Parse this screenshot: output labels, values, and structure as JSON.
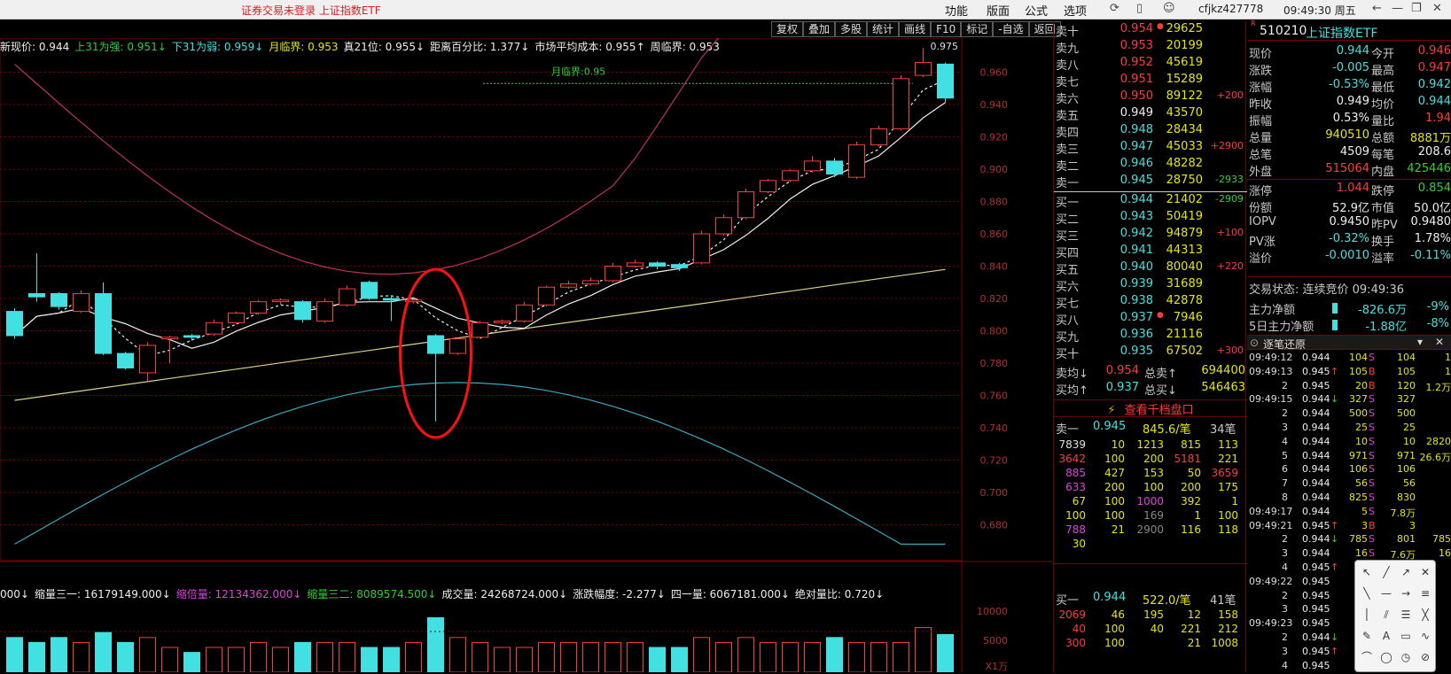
{
  "titlebar": {
    "notice": "证券交易未登录  上证指数ETF",
    "menus": [
      "功能",
      "版面",
      "公式",
      "选项"
    ],
    "account": "cfjkz427778",
    "clock": "09:49:30 周五"
  },
  "toolbar": [
    "复权",
    "叠加",
    "多股",
    "统计",
    "画线",
    "F10",
    "标记",
    "-自选",
    "返回"
  ],
  "infoline": [
    {
      "text": "新现价: 0.944",
      "color": "white"
    },
    {
      "text": "上31为强: 0.951↓",
      "color": "green"
    },
    {
      "text": "下31为弱: 0.959↓",
      "color": "cyan"
    },
    {
      "text": "月临界: 0.953",
      "color": "yellow"
    },
    {
      "text": "真21位: 0.955↓",
      "color": "white"
    },
    {
      "text": "距离百分比: 1.377↓",
      "color": "white"
    },
    {
      "text": "市场平均成本: 0.955↑",
      "color": "white"
    },
    {
      "text": "周临界: 0.953",
      "color": "white"
    }
  ],
  "volinfo": [
    {
      "text": "000↓",
      "color": "white"
    },
    {
      "text": "缩量三一: 16179149.000↓",
      "color": "white"
    },
    {
      "text": "缩倍量: 12134362.000↓",
      "color": "magenta"
    },
    {
      "text": "缩量三二: 8089574.500↓",
      "color": "green"
    },
    {
      "text": "成交量: 24268724.000↓",
      "color": "white"
    },
    {
      "text": "涨跌幅度: -2.277↓",
      "color": "white"
    },
    {
      "text": "四一量: 6067181.000↓",
      "color": "white"
    },
    {
      "text": "绝对量比: 0.720↓",
      "color": "white"
    }
  ],
  "chart_data": {
    "type": "candlestick",
    "annotations": {
      "month_critical_label": "月临界:0.95",
      "high_label": "0.975"
    },
    "ylim": [
      0.66,
      0.98
    ],
    "yticks": [
      0.68,
      0.7,
      0.72,
      0.74,
      0.76,
      0.78,
      0.8,
      0.82,
      0.84,
      0.86,
      0.88,
      0.9,
      0.92,
      0.94,
      0.96
    ],
    "vol_ticks": [
      "10000",
      "5000",
      "X1万"
    ],
    "candles": [
      {
        "o": 0.812,
        "c": 0.797,
        "h": 0.814,
        "l": 0.795
      },
      {
        "o": 0.823,
        "c": 0.821,
        "h": 0.848,
        "l": 0.818
      },
      {
        "o": 0.823,
        "c": 0.815,
        "h": 0.824,
        "l": 0.813
      },
      {
        "o": 0.812,
        "c": 0.823,
        "h": 0.825,
        "l": 0.811
      },
      {
        "o": 0.823,
        "c": 0.786,
        "h": 0.83,
        "l": 0.785
      },
      {
        "o": 0.786,
        "c": 0.777,
        "h": 0.787,
        "l": 0.776
      },
      {
        "o": 0.774,
        "c": 0.791,
        "h": 0.793,
        "l": 0.769
      },
      {
        "o": 0.795,
        "c": 0.796,
        "h": 0.797,
        "l": 0.78
      },
      {
        "o": 0.797,
        "c": 0.796,
        "h": 0.798,
        "l": 0.794
      },
      {
        "o": 0.798,
        "c": 0.805,
        "h": 0.807,
        "l": 0.797
      },
      {
        "o": 0.805,
        "c": 0.811,
        "h": 0.812,
        "l": 0.804
      },
      {
        "o": 0.811,
        "c": 0.818,
        "h": 0.819,
        "l": 0.81
      },
      {
        "o": 0.818,
        "c": 0.819,
        "h": 0.82,
        "l": 0.816
      },
      {
        "o": 0.818,
        "c": 0.807,
        "h": 0.819,
        "l": 0.805
      },
      {
        "o": 0.806,
        "c": 0.818,
        "h": 0.82,
        "l": 0.805
      },
      {
        "o": 0.816,
        "c": 0.826,
        "h": 0.828,
        "l": 0.815
      },
      {
        "o": 0.83,
        "c": 0.82,
        "h": 0.831,
        "l": 0.819
      },
      {
        "o": 0.82,
        "c": 0.819,
        "h": 0.822,
        "l": 0.806
      },
      {
        "o": 0.818,
        "c": 0.819,
        "h": 0.819,
        "l": 0.817
      },
      {
        "o": 0.797,
        "c": 0.786,
        "h": 0.798,
        "l": 0.744
      },
      {
        "o": 0.786,
        "c": 0.795,
        "h": 0.796,
        "l": 0.785
      },
      {
        "o": 0.796,
        "c": 0.805,
        "h": 0.806,
        "l": 0.795
      },
      {
        "o": 0.805,
        "c": 0.806,
        "h": 0.807,
        "l": 0.804
      },
      {
        "o": 0.806,
        "c": 0.816,
        "h": 0.818,
        "l": 0.805
      },
      {
        "o": 0.816,
        "c": 0.827,
        "h": 0.828,
        "l": 0.815
      },
      {
        "o": 0.827,
        "c": 0.829,
        "h": 0.831,
        "l": 0.826
      },
      {
        "o": 0.829,
        "c": 0.831,
        "h": 0.833,
        "l": 0.828
      },
      {
        "o": 0.831,
        "c": 0.84,
        "h": 0.842,
        "l": 0.83
      },
      {
        "o": 0.84,
        "c": 0.842,
        "h": 0.844,
        "l": 0.839
      },
      {
        "o": 0.842,
        "c": 0.84,
        "h": 0.843,
        "l": 0.838
      },
      {
        "o": 0.841,
        "c": 0.839,
        "h": 0.842,
        "l": 0.837
      },
      {
        "o": 0.842,
        "c": 0.86,
        "h": 0.862,
        "l": 0.841
      },
      {
        "o": 0.86,
        "c": 0.87,
        "h": 0.872,
        "l": 0.859
      },
      {
        "o": 0.87,
        "c": 0.886,
        "h": 0.888,
        "l": 0.869
      },
      {
        "o": 0.886,
        "c": 0.893,
        "h": 0.894,
        "l": 0.885
      },
      {
        "o": 0.893,
        "c": 0.899,
        "h": 0.9,
        "l": 0.892
      },
      {
        "o": 0.899,
        "c": 0.905,
        "h": 0.908,
        "l": 0.898
      },
      {
        "o": 0.905,
        "c": 0.897,
        "h": 0.907,
        "l": 0.895
      },
      {
        "o": 0.895,
        "c": 0.915,
        "h": 0.917,
        "l": 0.894
      },
      {
        "o": 0.915,
        "c": 0.925,
        "h": 0.927,
        "l": 0.914
      },
      {
        "o": 0.925,
        "c": 0.956,
        "h": 0.958,
        "l": 0.924
      },
      {
        "o": 0.958,
        "c": 0.966,
        "h": 0.975,
        "l": 0.957
      },
      {
        "o": 0.965,
        "c": 0.944,
        "h": 0.966,
        "l": 0.941
      }
    ],
    "volumes": [
      0.35,
      0.3,
      0.35,
      0.3,
      0.4,
      0.3,
      0.35,
      0.25,
      0.2,
      0.25,
      0.25,
      0.3,
      0.25,
      0.3,
      0.3,
      0.3,
      0.25,
      0.25,
      0.3,
      0.55,
      0.35,
      0.3,
      0.25,
      0.25,
      0.3,
      0.3,
      0.3,
      0.3,
      0.3,
      0.25,
      0.25,
      0.35,
      0.3,
      0.35,
      0.3,
      0.3,
      0.3,
      0.35,
      0.3,
      0.3,
      0.3,
      0.45,
      0.38
    ]
  },
  "orderbook": {
    "asks": [
      {
        "label": "卖十",
        "price": "0.954",
        "vol": "29625",
        "chg": "",
        "pc": "red",
        "mark": "●"
      },
      {
        "label": "卖九",
        "price": "0.953",
        "vol": "20199",
        "chg": "",
        "pc": "red",
        "mark": ""
      },
      {
        "label": "卖八",
        "price": "0.952",
        "vol": "45619",
        "chg": "",
        "pc": "red",
        "mark": ""
      },
      {
        "label": "卖七",
        "price": "0.951",
        "vol": "15289",
        "chg": "",
        "pc": "red",
        "mark": ""
      },
      {
        "label": "卖六",
        "price": "0.950",
        "vol": "89122",
        "chg": "+200",
        "pc": "red",
        "mark": ""
      },
      {
        "label": "卖五",
        "price": "0.949",
        "vol": "43570",
        "chg": "",
        "pc": "white",
        "mark": ""
      },
      {
        "label": "卖四",
        "price": "0.948",
        "vol": "28434",
        "chg": "",
        "pc": "cyan",
        "mark": ""
      },
      {
        "label": "卖三",
        "price": "0.947",
        "vol": "45033",
        "chg": "+2900",
        "pc": "cyan",
        "mark": ""
      },
      {
        "label": "卖二",
        "price": "0.946",
        "vol": "48282",
        "chg": "",
        "pc": "cyan",
        "mark": ""
      },
      {
        "label": "卖一",
        "price": "0.945",
        "vol": "28750",
        "chg": "-2933",
        "pc": "cyan",
        "mark": ""
      }
    ],
    "bids": [
      {
        "label": "买一",
        "price": "0.944",
        "vol": "21402",
        "chg": "-2909",
        "pc": "cyan",
        "mark": ""
      },
      {
        "label": "买二",
        "price": "0.943",
        "vol": "50419",
        "chg": "",
        "pc": "cyan",
        "mark": ""
      },
      {
        "label": "买三",
        "price": "0.942",
        "vol": "94879",
        "chg": "+100",
        "pc": "cyan",
        "mark": ""
      },
      {
        "label": "买四",
        "price": "0.941",
        "vol": "44313",
        "chg": "",
        "pc": "cyan",
        "mark": ""
      },
      {
        "label": "买五",
        "price": "0.940",
        "vol": "80040",
        "chg": "+220",
        "pc": "cyan",
        "mark": ""
      },
      {
        "label": "买六",
        "price": "0.939",
        "vol": "31689",
        "chg": "",
        "pc": "cyan",
        "mark": ""
      },
      {
        "label": "买七",
        "price": "0.938",
        "vol": "42878",
        "chg": "",
        "pc": "cyan",
        "mark": ""
      },
      {
        "label": "买八",
        "price": "0.937",
        "vol": "7946",
        "chg": "",
        "pc": "cyan",
        "mark": "●"
      },
      {
        "label": "买九",
        "price": "0.936",
        "vol": "21116",
        "chg": "",
        "pc": "cyan",
        "mark": ""
      },
      {
        "label": "买十",
        "price": "0.935",
        "vol": "67502",
        "chg": "+300",
        "pc": "cyan",
        "mark": ""
      }
    ],
    "avg_sell": {
      "label": "卖均↓",
      "price": "0.954",
      "tlabel": "总卖↑",
      "total": "694400"
    },
    "avg_buy": {
      "label": "买均↑",
      "price": "0.937",
      "tlabel": "总买↓",
      "total": "546463"
    },
    "depth_button": "查看千档盘口",
    "ask1_header": {
      "label": "卖一",
      "price": "0.945",
      "per": "845.6/笔",
      "count": "34笔"
    },
    "ask1_queue": [
      [
        "7839",
        "10",
        "1213",
        "815",
        "113"
      ],
      [
        "3642",
        "100",
        "200",
        "5181",
        "221"
      ],
      [
        "885",
        "427",
        "153",
        "50",
        "3659"
      ],
      [
        "633",
        "200",
        "100",
        "200",
        "175"
      ],
      [
        "67",
        "100",
        "1000",
        "392",
        "1"
      ],
      [
        "100",
        "100",
        "169",
        "1",
        "100"
      ],
      [
        "788",
        "21",
        "2900",
        "116",
        "118"
      ],
      [
        "30",
        "",
        "",
        "",
        ""
      ]
    ],
    "bid1_header": {
      "label": "买一",
      "price": "0.944",
      "per": "522.0/笔",
      "count": "41笔"
    },
    "bid1_queue": [
      [
        "2069",
        "46",
        "195",
        "12",
        "158"
      ],
      [
        "40",
        "100",
        "40",
        "221",
        "212"
      ],
      [
        "300",
        "100",
        "",
        "21",
        "1008"
      ]
    ]
  },
  "quote": {
    "code": "510210",
    "name": "上证指数ETF",
    "rows": [
      {
        "l1": "现价",
        "v1": "0.944",
        "c1": "cyan",
        "l2": "今开",
        "v2": "0.946",
        "c2": "red"
      },
      {
        "l1": "涨跌",
        "v1": "-0.005",
        "c1": "cyan",
        "l2": "最高",
        "v2": "0.947",
        "c2": "red"
      },
      {
        "l1": "涨幅",
        "v1": "-0.53%",
        "c1": "cyan",
        "l2": "最低",
        "v2": "0.942",
        "c2": "cyan"
      },
      {
        "l1": "昨收",
        "v1": "0.949",
        "c1": "white",
        "l2": "均价",
        "v2": "0.944",
        "c2": "cyan"
      },
      {
        "l1": "振幅",
        "v1": "0.53%",
        "c1": "white",
        "l2": "量比",
        "v2": "1.94",
        "c2": "red"
      },
      {
        "l1": "总量",
        "v1": "940510",
        "c1": "yellow",
        "l2": "总额",
        "v2": "8881万",
        "c2": "yellow"
      },
      {
        "l1": "总笔",
        "v1": "4509",
        "c1": "white",
        "l2": "每笔",
        "v2": "208.6",
        "c2": "white"
      },
      {
        "l1": "外盘",
        "v1": "515064",
        "c1": "red",
        "l2": "内盘",
        "v2": "425446",
        "c2": "green"
      },
      {
        "l1": "涨停",
        "v1": "1.044",
        "c1": "red",
        "l2": "跌停",
        "v2": "0.854",
        "c2": "green"
      },
      {
        "l1": "份额",
        "v1": "52.9亿",
        "c1": "white",
        "l2": "市值",
        "v2": "50.0亿",
        "c2": "white"
      },
      {
        "l1": "IOPV",
        "v1": "0.9450",
        "c1": "white",
        "l2": "昨PV",
        "v2": "0.9480",
        "c2": "white"
      },
      {
        "l1": "PV涨",
        "v1": "-0.32%",
        "c1": "cyan",
        "l2": "换手",
        "v2": "1.78%",
        "c2": "white"
      },
      {
        "l1": "溢价",
        "v1": "-0.0010",
        "c1": "cyan",
        "l2": "溢率",
        "v2": "-0.11%",
        "c2": "cyan"
      }
    ],
    "trade_status": "交易状态: 连续竞价 09:49:36",
    "main_flow": {
      "label": "主力净额",
      "value": "-826.6万",
      "pct": "-9%"
    },
    "main_flow5": {
      "label": "5日主力净额",
      "value": "-1.88亿",
      "pct": "-8%"
    },
    "tick_title": "逐笔还原",
    "ticks": [
      {
        "t": "09:49:12",
        "p": "0.944",
        "a": "",
        "v": "104",
        "s": "S",
        "x": "104",
        "y": "1"
      },
      {
        "t": "09:49:13",
        "p": "0.945",
        "a": "↑",
        "v": "105",
        "s": "B",
        "x": "105",
        "y": "1"
      },
      {
        "t": "2",
        "p": "0.945",
        "a": "",
        "v": "20",
        "s": "B",
        "x": "120",
        "y": "1.2万"
      },
      {
        "t": "09:49:15",
        "p": "0.944",
        "a": "↓",
        "v": "327",
        "s": "S",
        "x": "327",
        "y": ""
      },
      {
        "t": "2",
        "p": "0.944",
        "a": "",
        "v": "500",
        "s": "S",
        "x": "500",
        "y": ""
      },
      {
        "t": "3",
        "p": "0.944",
        "a": "",
        "v": "25",
        "s": "S",
        "x": "25",
        "y": ""
      },
      {
        "t": "4",
        "p": "0.944",
        "a": "",
        "v": "10",
        "s": "S",
        "x": "10",
        "y": "2820"
      },
      {
        "t": "5",
        "p": "0.944",
        "a": "",
        "v": "971",
        "s": "S",
        "x": "971",
        "y": "26.6万"
      },
      {
        "t": "6",
        "p": "0.944",
        "a": "",
        "v": "106",
        "s": "S",
        "x": "106",
        "y": ""
      },
      {
        "t": "7",
        "p": "0.944",
        "a": "",
        "v": "56",
        "s": "S",
        "x": "56",
        "y": ""
      },
      {
        "t": "8",
        "p": "0.944",
        "a": "",
        "v": "825",
        "s": "S",
        "x": "830",
        "y": ""
      },
      {
        "t": "09:49:17",
        "p": "0.944",
        "a": "",
        "v": "5",
        "s": "S",
        "x": "7.8万",
        "y": ""
      },
      {
        "t": "09:49:21",
        "p": "0.945",
        "a": "↑",
        "v": "3",
        "s": "B",
        "x": "3",
        "y": ""
      },
      {
        "t": "2",
        "p": "0.944",
        "a": "↓",
        "v": "785",
        "s": "S",
        "x": "801",
        "y": "785"
      },
      {
        "t": "3",
        "p": "0.944",
        "a": "",
        "v": "16",
        "s": "S",
        "x": "7.6万",
        "y": "16"
      },
      {
        "t": "4",
        "p": "0.945",
        "a": "↑",
        "v": "",
        "s": "",
        "x": "",
        "y": ""
      },
      {
        "t": "09:49:22",
        "p": "0.945",
        "a": "",
        "v": "",
        "s": "",
        "x": "",
        "y": ""
      },
      {
        "t": "2",
        "p": "0.945",
        "a": "",
        "v": "",
        "s": "",
        "x": "",
        "y": ""
      },
      {
        "t": "3",
        "p": "0.945",
        "a": "",
        "v": "",
        "s": "",
        "x": "",
        "y": ""
      },
      {
        "t": "09:49:23",
        "p": "0.945",
        "a": "",
        "v": "",
        "s": "",
        "x": "",
        "y": ""
      },
      {
        "t": "2",
        "p": "0.944",
        "a": "↓",
        "v": "",
        "s": "",
        "x": "",
        "y": ""
      },
      {
        "t": "3",
        "p": "0.945",
        "a": "↑",
        "v": "",
        "s": "",
        "x": "",
        "y": ""
      },
      {
        "t": "4",
        "p": "0.945",
        "a": "",
        "v": "",
        "s": "",
        "x": "",
        "y": ""
      }
    ]
  }
}
